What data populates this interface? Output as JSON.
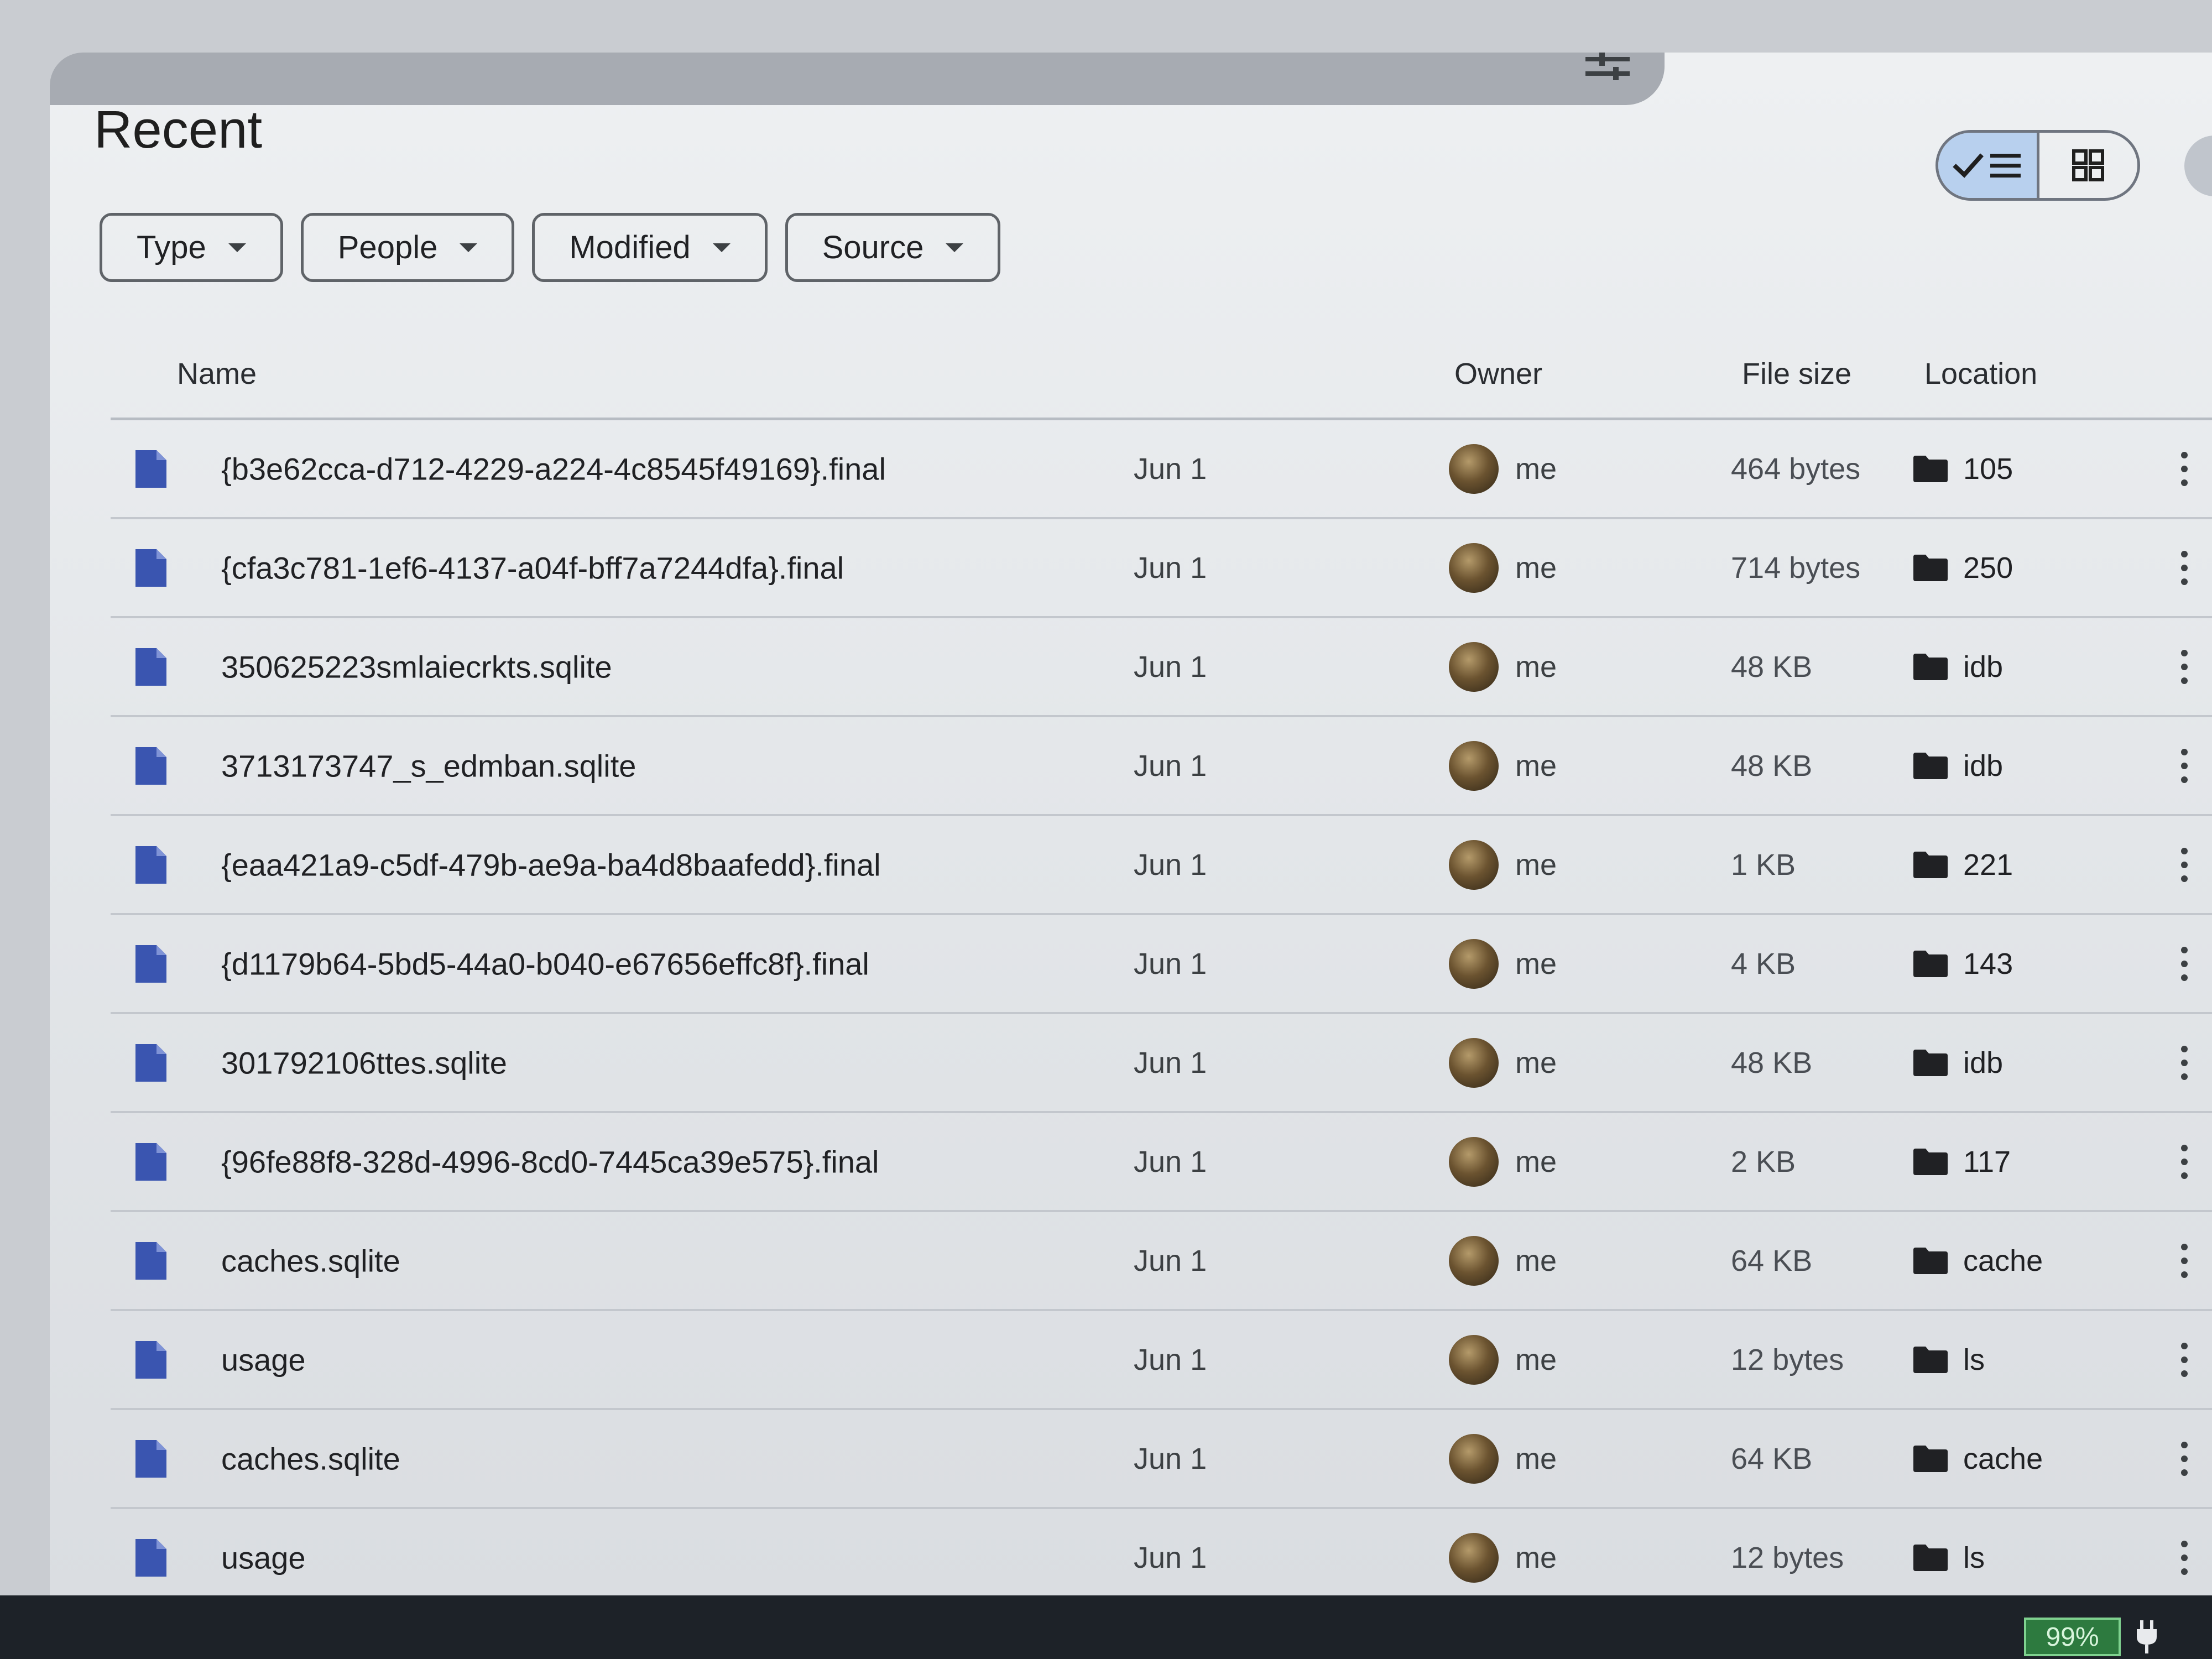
{
  "page": {
    "title": "Recent"
  },
  "filters": [
    {
      "label": "Type"
    },
    {
      "label": "People"
    },
    {
      "label": "Modified"
    },
    {
      "label": "Source"
    }
  ],
  "view_toggle": {
    "active": "list",
    "icons": [
      "checkmark-icon",
      "list-icon",
      "grid-icon"
    ]
  },
  "columns": {
    "name": "Name",
    "owner": "Owner",
    "size": "File size",
    "location": "Location"
  },
  "rows": [
    {
      "name": "{b3e62cca-d712-4229-a224-4c8545f49169}.final",
      "date": "Jun 1",
      "owner": "me",
      "size": "464 bytes",
      "location": "105"
    },
    {
      "name": "{cfa3c781-1ef6-4137-a04f-bff7a7244dfa}.final",
      "date": "Jun 1",
      "owner": "me",
      "size": "714 bytes",
      "location": "250"
    },
    {
      "name": "350625223smlaiecrkts.sqlite",
      "date": "Jun 1",
      "owner": "me",
      "size": "48 KB",
      "location": "idb"
    },
    {
      "name": "3713173747_s_edmban.sqlite",
      "date": "Jun 1",
      "owner": "me",
      "size": "48 KB",
      "location": "idb"
    },
    {
      "name": "{eaa421a9-c5df-479b-ae9a-ba4d8baafedd}.final",
      "date": "Jun 1",
      "owner": "me",
      "size": "1 KB",
      "location": "221"
    },
    {
      "name": "{d1179b64-5bd5-44a0-b040-e67656effc8f}.final",
      "date": "Jun 1",
      "owner": "me",
      "size": "4 KB",
      "location": "143"
    },
    {
      "name": "301792106ttes.sqlite",
      "date": "Jun 1",
      "owner": "me",
      "size": "48 KB",
      "location": "idb"
    },
    {
      "name": "{96fe88f8-328d-4996-8cd0-7445ca39e575}.final",
      "date": "Jun 1",
      "owner": "me",
      "size": "2 KB",
      "location": "117"
    },
    {
      "name": "caches.sqlite",
      "date": "Jun 1",
      "owner": "me",
      "size": "64 KB",
      "location": "cache"
    },
    {
      "name": "usage",
      "date": "Jun 1",
      "owner": "me",
      "size": "12 bytes",
      "location": "ls"
    },
    {
      "name": "caches.sqlite",
      "date": "Jun 1",
      "owner": "me",
      "size": "64 KB",
      "location": "cache"
    },
    {
      "name": "usage",
      "date": "Jun 1",
      "owner": "me",
      "size": "12 bytes",
      "location": "ls"
    }
  ],
  "status": {
    "battery": "99%"
  },
  "colors": {
    "file_icon": "#3a55b0",
    "selected_toggle": "#b8d0ee",
    "folder_icon": "#202124"
  }
}
